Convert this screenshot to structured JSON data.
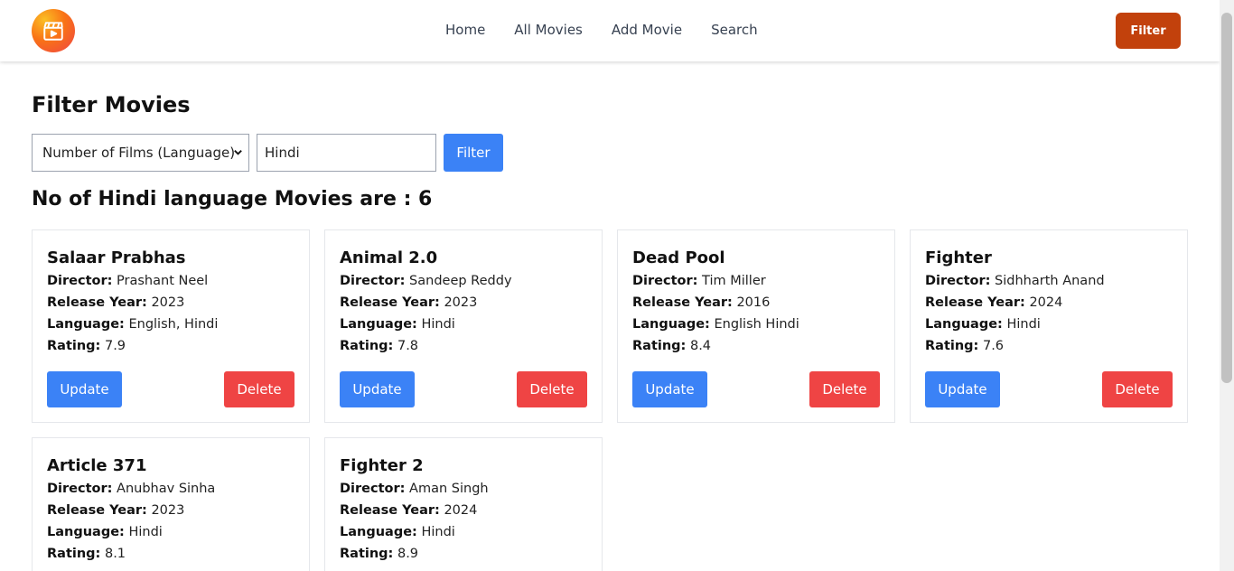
{
  "nav": {
    "links": [
      "Home",
      "All Movies",
      "Add Movie",
      "Search"
    ],
    "filter_label": "Filter",
    "logo_icon": "clapperboard-icon"
  },
  "page": {
    "title": "Filter Movies",
    "select_value": "Number of Films (Language)",
    "input_value": "Hindi",
    "filter_button": "Filter",
    "result_heading": "No of Hindi language Movies are : 6"
  },
  "labels": {
    "director": "Director:",
    "release_year": "Release Year:",
    "language": "Language:",
    "rating": "Rating:",
    "update": "Update",
    "delete": "Delete"
  },
  "movies": [
    {
      "title": "Salaar Prabhas",
      "director": "Prashant Neel",
      "year": "2023",
      "language": "English, Hindi",
      "rating": "7.9"
    },
    {
      "title": "Animal 2.0",
      "director": "Sandeep Reddy",
      "year": "2023",
      "language": "Hindi",
      "rating": "7.8"
    },
    {
      "title": "Dead Pool",
      "director": "Tim Miller",
      "year": "2016",
      "language": "English Hindi",
      "rating": "8.4"
    },
    {
      "title": "Fighter",
      "director": "Sidhharth Anand",
      "year": "2024",
      "language": "Hindi",
      "rating": "7.6"
    },
    {
      "title": "Article 371",
      "director": "Anubhav Sinha",
      "year": "2023",
      "language": "Hindi",
      "rating": "8.1"
    },
    {
      "title": "Fighter 2",
      "director": "Aman Singh",
      "year": "2024",
      "language": "Hindi",
      "rating": "8.9"
    }
  ],
  "colors": {
    "primary": "#3b82f6",
    "danger": "#ef4444",
    "nav_filter": "#c2410c"
  }
}
